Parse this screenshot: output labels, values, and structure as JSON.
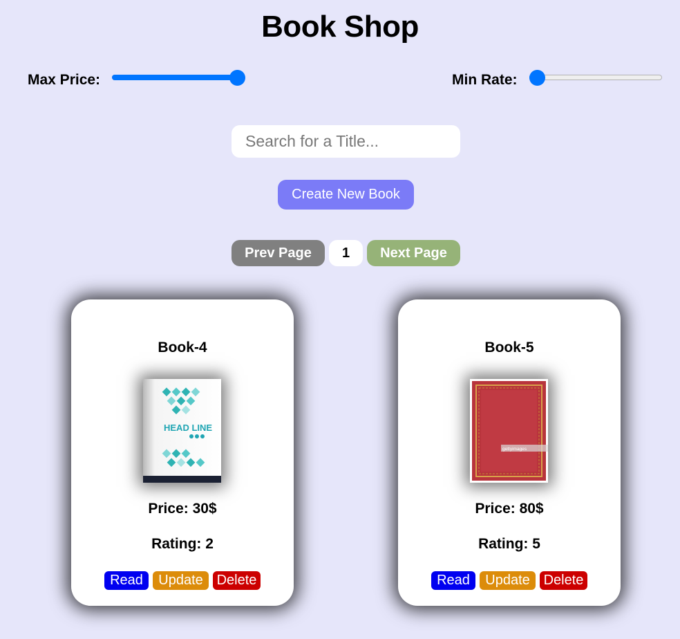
{
  "header": {
    "title": "Book Shop"
  },
  "filters": {
    "max_price_label": "Max Price:",
    "max_price_level": 1.0,
    "min_rate_label": "Min Rate:",
    "min_rate_level": 0.0
  },
  "search": {
    "placeholder": "Search for a Title...",
    "value": ""
  },
  "create_label": "Create New Book",
  "pager": {
    "prev_label": "Prev Page",
    "page": "1",
    "next_label": "Next Page"
  },
  "books": [
    {
      "title": "Book-4",
      "price": "Price: 30$",
      "rating": "Rating: 2",
      "cover_icon": "headline-cover",
      "cover_text": "HEAD LINE"
    },
    {
      "title": "Book-5",
      "price": "Price: 80$",
      "rating": "Rating: 5",
      "cover_icon": "red-leather-cover",
      "cover_text": "gettyimages"
    }
  ],
  "actions": {
    "read": "Read",
    "update": "Update",
    "delete": "Delete"
  },
  "colors": {
    "background": "#e6e6fa",
    "slider": "#0075ff",
    "create": "#7b7bf7",
    "prev": "#808080",
    "next": "#96b378",
    "read": "#0000f0",
    "update": "#dc8c0a",
    "delete": "#cc0000"
  }
}
